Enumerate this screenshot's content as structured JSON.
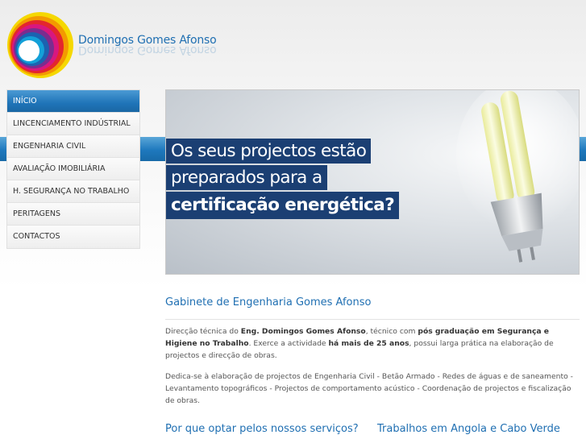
{
  "header": {
    "brand_name": "Domingos Gomes Afonso"
  },
  "nav": {
    "items": [
      {
        "label": "INÍCIO",
        "active": true
      },
      {
        "label": "LINCENCIAMENTO INDÚSTRIAL",
        "active": false
      },
      {
        "label": "ENGENHARIA CIVIL",
        "active": false
      },
      {
        "label": "AVALIAÇÃO IMOBILIÁRIA",
        "active": false
      },
      {
        "label": "H. SEGURANÇA NO TRABALHO",
        "active": false
      },
      {
        "label": "PERITAGENS",
        "active": false
      },
      {
        "label": "CONTACTOS",
        "active": false
      }
    ]
  },
  "banner": {
    "line1": "Os seus projectos estão",
    "line2": "preparados para a",
    "line3": "certificação energética?"
  },
  "main": {
    "title": "Gabinete de Engenharia Gomes Afonso",
    "para1": {
      "t1": "Direcção técnica do ",
      "b1": "Eng. Domingos Gomes Afonso",
      "t2": ", técnico com ",
      "b2": "pós graduação em Segurança e Higiene no Trabalho",
      "t3": ". Exerce a actividade ",
      "b3": "há mais de 25 anos",
      "t4": ", possui larga prática na elaboração de projectos e direcção de obras."
    },
    "para2": "Dedica-se à elaboração de projectos de Engenharia Civil - Betão Armado - Redes de águas e de saneamento - Levantamento topográficos - Projectos de comportamento acústico - Coordenação de projectos e fiscalização de obras.",
    "subtitle_left": "Por que optar pelos nossos serviços?",
    "subtitle_right": "Trabalhos em Angola e Cabo Verde"
  },
  "colors": {
    "accent_blue": "#1f6fb2",
    "nav_active": "#1f74b8",
    "banner_text_bg": "#1b3f73"
  },
  "icons": {
    "logo": "rainbow-circle-logo",
    "banner_image": "energy-saving-bulb"
  }
}
